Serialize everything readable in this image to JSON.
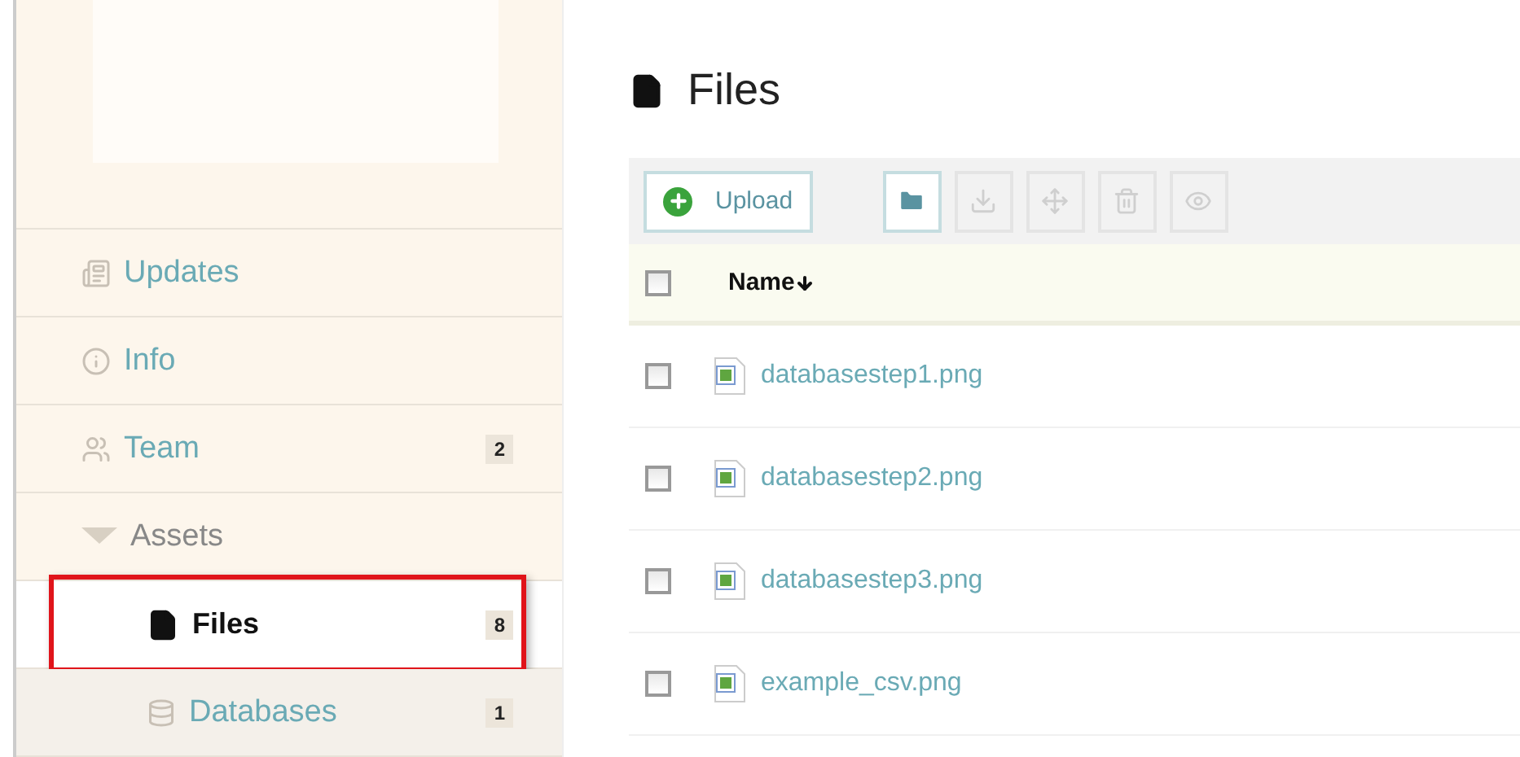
{
  "sidebar": {
    "items": [
      {
        "label": "Updates",
        "kind": "updates",
        "selected": false
      },
      {
        "label": "Info",
        "kind": "info",
        "selected": false
      },
      {
        "label": "Team",
        "kind": "team",
        "badge": "2",
        "selected": false
      },
      {
        "label": "Assets",
        "kind": "group",
        "selected": false,
        "expanded": true,
        "children": [
          {
            "label": "Files",
            "kind": "files",
            "badge": "8",
            "selected": true
          },
          {
            "label": "Databases",
            "kind": "databases",
            "badge": "1",
            "selected": false
          }
        ]
      }
    ]
  },
  "page": {
    "title": "Files"
  },
  "toolbar": {
    "buttons": [
      {
        "kind": "upload",
        "label": "Upload",
        "disabled": false
      },
      {
        "kind": "new-folder",
        "disabled": false
      },
      {
        "kind": "download",
        "disabled": true
      },
      {
        "kind": "move",
        "disabled": true
      },
      {
        "kind": "delete",
        "disabled": true
      },
      {
        "kind": "preview",
        "disabled": true
      }
    ]
  },
  "table": {
    "header": {
      "label": "Name",
      "checked": false
    },
    "rows": [
      {
        "name": "databasestep1.png",
        "checked": false
      },
      {
        "name": "databasestep2.png",
        "checked": false
      },
      {
        "name": "databasestep3.png",
        "checked": false
      },
      {
        "name": "example_csv.png",
        "checked": false
      }
    ]
  }
}
